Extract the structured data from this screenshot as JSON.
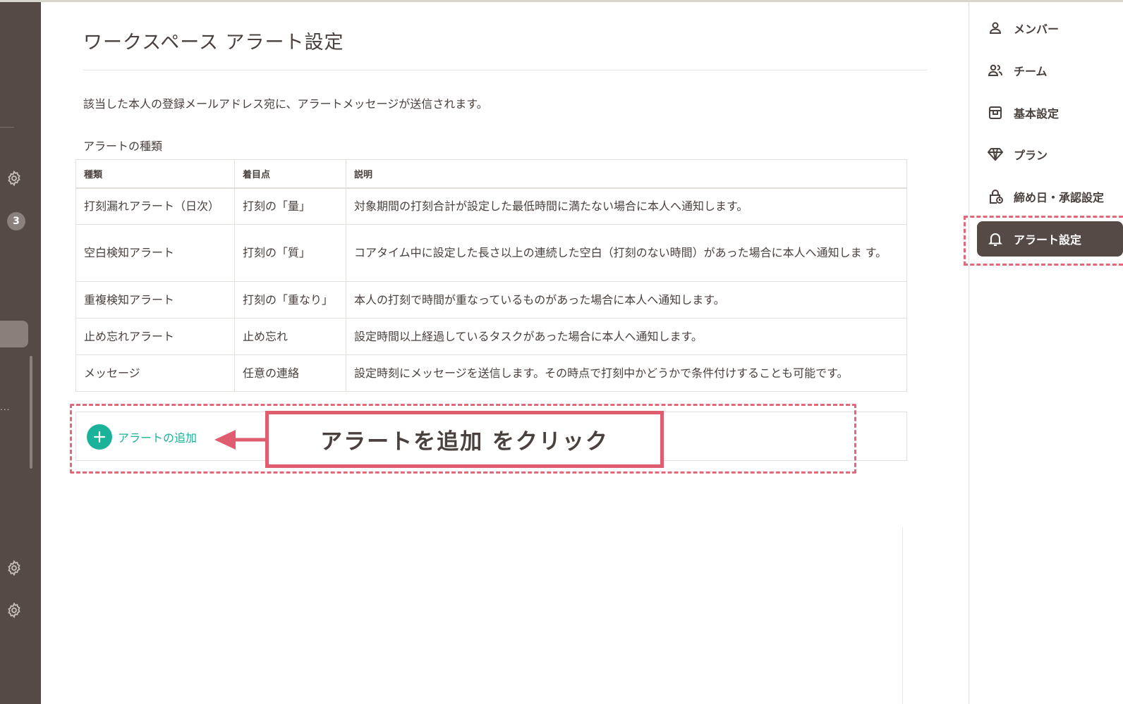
{
  "page": {
    "title": "ワークスペース アラート設定",
    "description": "該当した本人の登録メールアドレス宛に、アラートメッセージが送信されます。",
    "section_label": "アラートの種類"
  },
  "left_sidebar": {
    "badge_count": "3",
    "ellipsis": "..."
  },
  "table": {
    "headers": [
      "種類",
      "着目点",
      "説明"
    ],
    "rows": [
      [
        "打刻漏れアラート（日次）",
        "打刻の「量」",
        "対象期間の打刻合計が設定した最低時間に満たない場合に本人へ通知します。"
      ],
      [
        "空白検知アラート",
        "打刻の「質」",
        "コアタイム中に設定した長さ以上の連続した空白（打刻のない時間）があった場合に本人へ通知しま す。"
      ],
      [
        "重複検知アラート",
        "打刻の「重なり」",
        "本人の打刻で時間が重なっているものがあった場合に本人へ通知します。"
      ],
      [
        "止め忘れアラート",
        "止め忘れ",
        "設定時間以上経過しているタスクがあった場合に本人へ通知します。"
      ],
      [
        "メッセージ",
        "任意の連絡",
        "設定時刻にメッセージを送信します。その時点で打刻中かどうかで条件付けすることも可能です。"
      ]
    ]
  },
  "add_alert": {
    "label": "アラートの追加",
    "icon": "plus-icon"
  },
  "callout": {
    "text": "アラートを追加 をクリック"
  },
  "right_nav": {
    "items": [
      {
        "label": "メンバー",
        "icon": "person-icon",
        "active": false
      },
      {
        "label": "チーム",
        "icon": "people-icon",
        "active": false
      },
      {
        "label": "基本設定",
        "icon": "box-icon",
        "active": false
      },
      {
        "label": "プラン",
        "icon": "diamond-icon",
        "active": false
      },
      {
        "label": "締め日・承認設定",
        "icon": "lock-clock-icon",
        "active": false
      },
      {
        "label": "アラート設定",
        "icon": "bell-icon",
        "active": true
      }
    ]
  },
  "colors": {
    "sidebar_dark": "#564a46",
    "accent_green": "#1ab39a",
    "annotation_red": "#e05d6f",
    "text": "#4a403d"
  }
}
